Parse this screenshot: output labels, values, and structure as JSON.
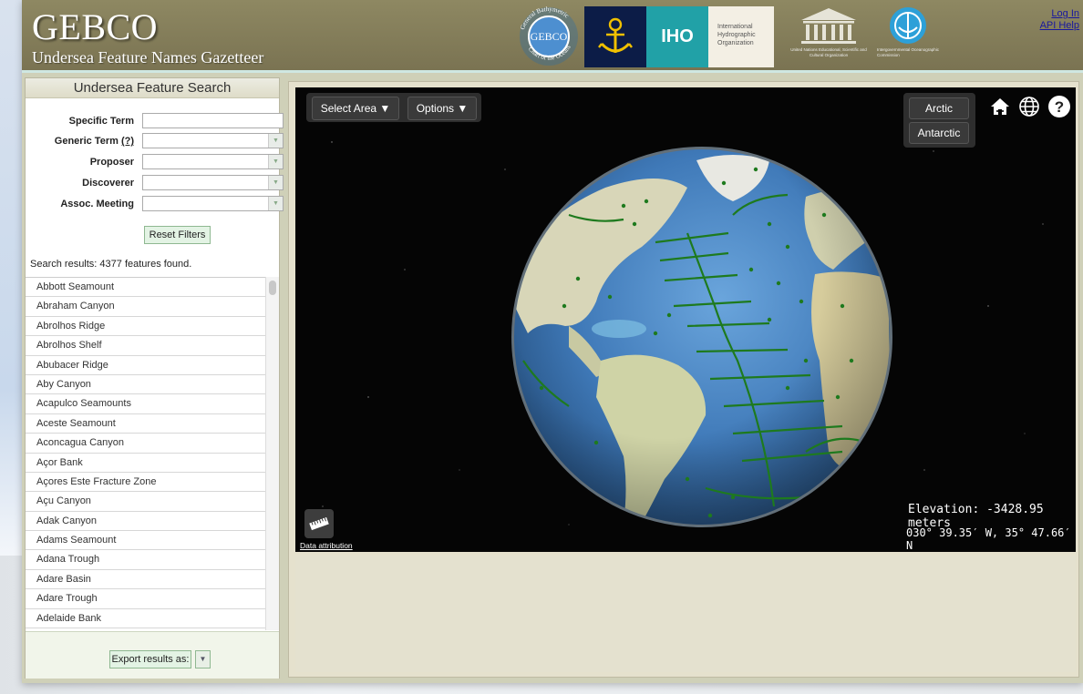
{
  "header": {
    "title": "GEBCO",
    "subtitle": "Undersea Feature Names Gazetteer",
    "login": "Log In",
    "api_help": "API Help",
    "iho_abbrev": "IHO",
    "iho_name": [
      "International",
      "Hydrographic",
      "Organization"
    ],
    "gebco_ring_top": "General Bathymetric",
    "gebco_ring_bottom": "Chart of the Oceans",
    "gebco_center": "GEBCO",
    "unesco_text": "United Nations Educational, Scientific and Cultural Organization",
    "ioc_text": "Intergovernmental Oceanographic Commission"
  },
  "search_panel": {
    "title": "Undersea Feature Search",
    "labels": {
      "specific_term": "Specific Term",
      "generic_term": "Generic Term",
      "generic_help": "(?)",
      "proposer": "Proposer",
      "discoverer": "Discoverer",
      "assoc_meeting": "Assoc. Meeting"
    },
    "values": {
      "specific_term": "",
      "generic_term": "",
      "proposer": "",
      "discoverer": "",
      "assoc_meeting": ""
    },
    "reset_label": "Reset Filters",
    "results_text": "Search results: 4377 features found.",
    "results": [
      "Abbott Seamount",
      "Abraham Canyon",
      "Abrolhos Ridge",
      "Abrolhos Shelf",
      "Abubacer Ridge",
      "Aby Canyon",
      "Acapulco Seamounts",
      "Aceste Seamount",
      "Aconcagua Canyon",
      "Açor Bank",
      "Açores Este Fracture Zone",
      "Açu Canyon",
      "Adak Canyon",
      "Adams Seamount",
      "Adana Trough",
      "Adare Basin",
      "Adare Trough",
      "Adelaide Bank"
    ],
    "export_label": "Export results as:"
  },
  "map": {
    "select_area": "Select Area ▼",
    "options": "Options ▼",
    "arctic": "Arctic",
    "antarctic": "Antarctic",
    "elevation": "Elevation: -3428.95 meters",
    "coordinates": "030° 39.35′ W, 35° 47.66′ N",
    "attribution": "Data attribution",
    "colors": {
      "ocean": "#3f79b8",
      "land": "#d8d6b8",
      "features": "#1e7a1e"
    }
  }
}
